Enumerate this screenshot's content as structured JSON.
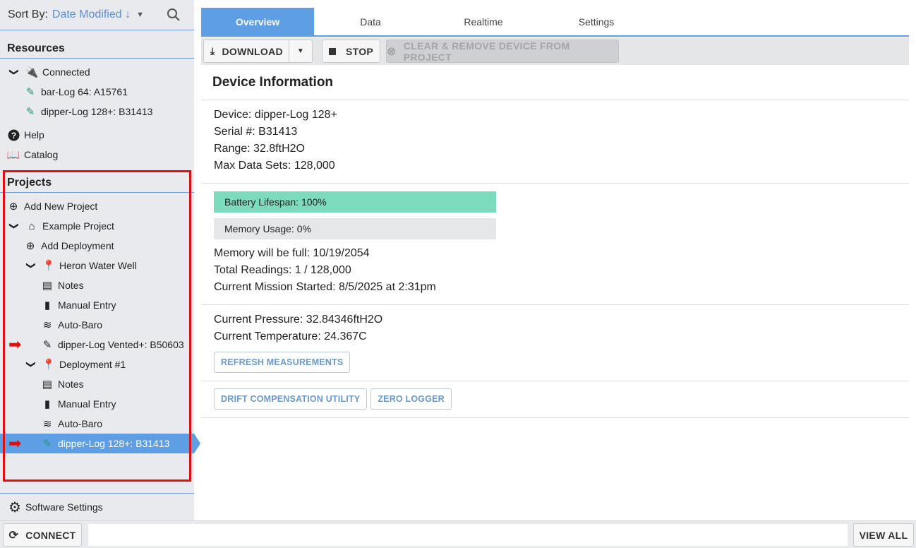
{
  "sidebar": {
    "sort_label": "Sort By:",
    "sort_value": "Date Modified ↓",
    "resources_title": "Resources",
    "connected": "Connected",
    "connected_devices": [
      "bar-Log 64: A15761",
      "dipper-Log 128+: B31413"
    ],
    "help": "Help",
    "catalog": "Catalog",
    "projects_title": "Projects",
    "add_project": "Add New Project",
    "project": "Example Project",
    "add_deployment": "Add Deployment",
    "deployments": [
      {
        "name": "Heron Water Well",
        "notes": "Notes",
        "manual": "Manual Entry",
        "baro": "Auto-Baro",
        "device": "dipper-Log Vented+: B50603"
      },
      {
        "name": "Deployment #1",
        "notes": "Notes",
        "manual": "Manual Entry",
        "baro": "Auto-Baro",
        "device": "dipper-Log 128+: B31413"
      }
    ],
    "software_settings": "Software Settings"
  },
  "tabs": [
    "Overview",
    "Data",
    "Realtime",
    "Settings"
  ],
  "toolbar": {
    "download": "DOWNLOAD",
    "stop": "STOP",
    "clear": "CLEAR & REMOVE DEVICE FROM PROJECT"
  },
  "main": {
    "title": "Device Information",
    "device": "Device: dipper-Log 128+",
    "serial": "Serial #: B31413",
    "range": "Range: 32.8ftH2O",
    "max_sets": "Max Data Sets: 128,000",
    "battery": "Battery Lifespan: 100%",
    "battery_pct": 100,
    "memory": "Memory Usage: 0%",
    "memory_pct": 0,
    "memory_full": "Memory will be full: 10/19/2054",
    "total_readings": "Total Readings: 1 / 128,000",
    "mission": "Current Mission Started: 8/5/2025 at 2:31pm",
    "pressure": "Current Pressure: 32.84346ftH2O",
    "temperature": "Current Temperature: 24.367C",
    "refresh": "REFRESH MEASUREMENTS",
    "drift": "DRIFT COMPENSATION UTILITY",
    "zero": "ZERO LOGGER"
  },
  "bottom": {
    "connect": "CONNECT",
    "view_all": "VIEW ALL"
  },
  "colors": {
    "accent": "#5e9ee4",
    "battery": "#7ddbbd",
    "highlight": "#e01010",
    "pencil": "#1a9e6e"
  }
}
